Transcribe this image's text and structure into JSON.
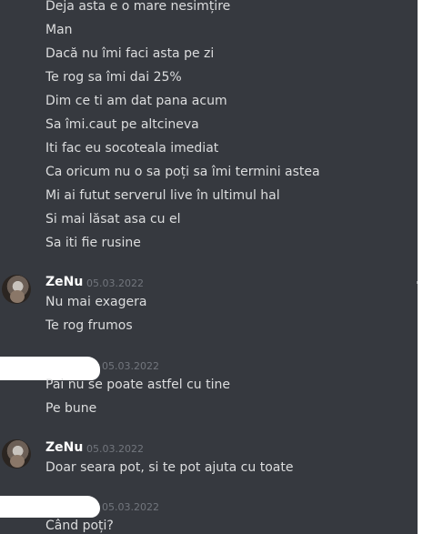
{
  "top_messages": [
    "Deja asta e o mare nesimțire",
    "Man",
    "Dacă nu îmi faci asta pe zi",
    "Te rog sa îmi dai 25%",
    "Dim ce ti am dat pana acum",
    "Sa îmi.caut pe altcineva",
    "Iti fac eu socoteala imediat",
    "Ca oricum nu o sa poți sa îmi  termini astea",
    "Mi ai futut serverul live în ultimul hal",
    "Si mai lăsat asa cu el",
    "Sa iti fie rusine"
  ],
  "groups": [
    {
      "author": "ZeNu",
      "timestamp": "05.03.2022",
      "messages": [
        "Nu mai exagera",
        "Te rog frumos"
      ]
    },
    {
      "author": "",
      "timestamp": "05.03.2022",
      "messages": [
        "Pai nu se poate astfel cu tine",
        "Pe bune"
      ]
    },
    {
      "author": "ZeNu",
      "timestamp": "05.03.2022",
      "messages": [
        "Doar seara pot, si te pot ajuta cu toate"
      ]
    },
    {
      "author": "",
      "timestamp": "05.03.2022",
      "messages": [
        "Când poți?"
      ]
    }
  ]
}
